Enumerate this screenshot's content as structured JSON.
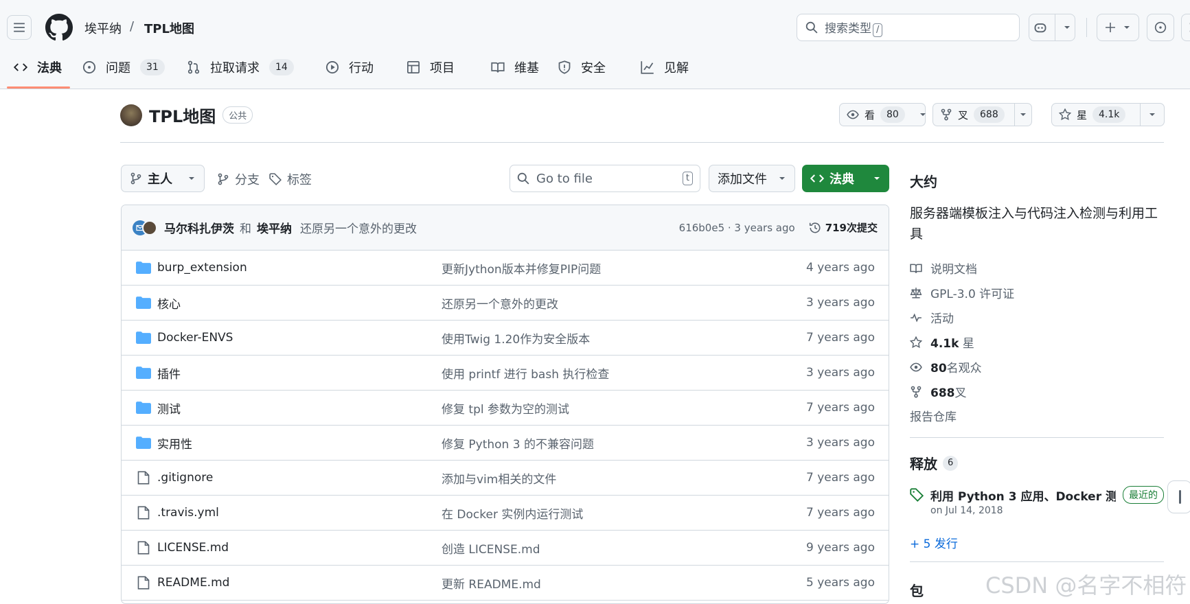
{
  "header": {
    "owner": "埃平纳",
    "separator": "/",
    "repo": "TPL地图",
    "search_placeholder": "搜索类型",
    "search_key": "/"
  },
  "nav": {
    "tabs": [
      {
        "label": "法典",
        "icon": "code-icon",
        "selected": true
      },
      {
        "label": "问题",
        "icon": "issue-icon",
        "count": "31"
      },
      {
        "label": "拉取请求",
        "icon": "pull-request-icon",
        "count": "14"
      },
      {
        "label": "行动",
        "icon": "play-icon"
      },
      {
        "label": "项目",
        "icon": "table-icon"
      },
      {
        "label": "维基",
        "icon": "book-icon"
      },
      {
        "label": "安全",
        "icon": "shield-icon"
      },
      {
        "label": "见解",
        "icon": "graph-icon"
      }
    ]
  },
  "repo": {
    "name": "TPL地图",
    "visibility": "公共",
    "watch_label": "看",
    "watch_count": "80",
    "fork_label": "叉",
    "fork_count": "688",
    "star_label": "星",
    "star_count": "4.1k"
  },
  "toolbar": {
    "branch": "主人",
    "branches": "分支",
    "tags": "标签",
    "go_to_file": "Go to file",
    "go_to_file_key": "t",
    "add_file": "添加文件",
    "code": "法典"
  },
  "commit": {
    "author1": "马尔科扎伊茨",
    "and": "和",
    "author2": "埃平纳",
    "message": "还原另一个意外的更改",
    "sha_time": "616b0e5 · 3 years ago",
    "commits": "719次提交"
  },
  "files": [
    {
      "type": "folder",
      "name": "burp_extension",
      "message": "更新Jython版本并修复PIP问题",
      "age": "4 years ago"
    },
    {
      "type": "folder",
      "name": "核心",
      "message": "还原另一个意外的更改",
      "age": "3 years ago"
    },
    {
      "type": "folder",
      "name": "Docker-ENVS",
      "message": "使用Twig 1.20作为安全版本",
      "age": "7 years ago"
    },
    {
      "type": "folder",
      "name": "插件",
      "message": "使用 printf 进行 bash 执行检查",
      "age": "3 years ago"
    },
    {
      "type": "folder",
      "name": "测试",
      "message": "修复 tpl 参数为空的测试",
      "age": "7 years ago"
    },
    {
      "type": "folder",
      "name": "实用性",
      "message": "修复 Python 3 的不兼容问题",
      "age": "3 years ago"
    },
    {
      "type": "file",
      "name": ".gitignore",
      "message": "添加与vim相关的文件",
      "age": "7 years ago"
    },
    {
      "type": "file",
      "name": ".travis.yml",
      "message": "在 Docker 实例内运行测试",
      "age": "7 years ago"
    },
    {
      "type": "file",
      "name": "LICENSE.md",
      "message": "创造 LICENSE.md",
      "age": "9 years ago"
    },
    {
      "type": "file",
      "name": "README.md",
      "message": "更新 README.md",
      "age": "5 years ago"
    }
  ],
  "about": {
    "title": "大约",
    "description": "服务器端模板注入与代码注入检测与利用工具",
    "readme": "说明文档",
    "license": "GPL-3.0 许可证",
    "activity": "活动",
    "stars_num": "4.1k",
    "stars_label": "星",
    "watchers_num": "80",
    "watchers_label": "名观众",
    "forks_num": "688",
    "forks_label": "叉",
    "report": "报告仓库"
  },
  "releases": {
    "title": "释放",
    "count": "6",
    "latest_name": "利用 Python 3 应用、Docker 测...",
    "latest_badge": "最近的",
    "latest_date": "on Jul 14, 2018",
    "more": "+ 5 发行"
  },
  "packages": {
    "title": "包"
  },
  "watermark": "CSDN @名字不相符",
  "colors": {
    "accent": "#fd8c73",
    "primary": "#1f883d",
    "link": "#0969da",
    "folder": "#54aeff"
  }
}
